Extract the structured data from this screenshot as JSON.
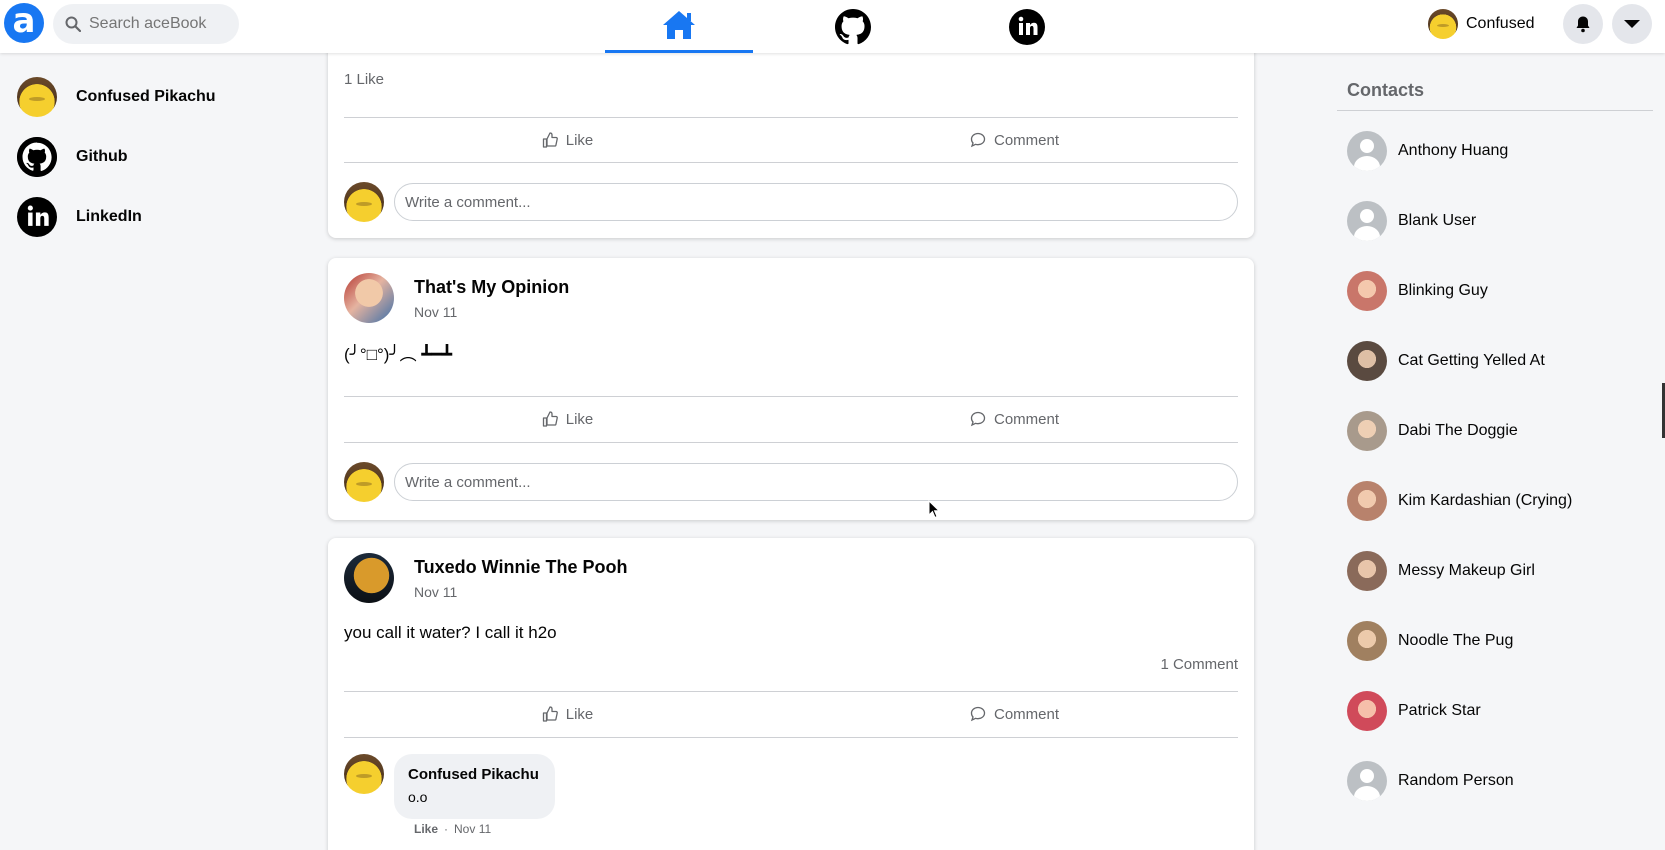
{
  "header": {
    "search_placeholder": "Search aceBook",
    "logo_letter": "a",
    "profile_name": "Confused",
    "tabs": [
      "home",
      "github",
      "linkedin"
    ],
    "active_tab": "home",
    "accent": "#1877f2"
  },
  "sidebar": {
    "items": [
      {
        "label": "Confused Pikachu",
        "icon": "pikachu-avatar"
      },
      {
        "label": "Github",
        "icon": "github-icon"
      },
      {
        "label": "LinkedIn",
        "icon": "linkedin-icon"
      }
    ]
  },
  "feed": {
    "post1": {
      "likes": "1 Like",
      "like_label": "Like",
      "comment_label": "Comment",
      "comment_placeholder": "Write a comment..."
    },
    "post2": {
      "author": "That's My Opinion",
      "date": "Nov 11",
      "text": "(╯°□°)╯︵ ┻━┻",
      "like_label": "Like",
      "comment_label": "Comment",
      "comment_placeholder": "Write a comment..."
    },
    "post3": {
      "author": "Tuxedo Winnie The Pooh",
      "date": "Nov 11",
      "text": "you call it water? I call it h2o",
      "comments_count": "1 Comment",
      "like_label": "Like",
      "comment_label": "Comment",
      "reply": {
        "author": "Confused Pikachu",
        "text": "o.o",
        "like_label": "Like",
        "separator": "·",
        "date": "Nov 11"
      }
    }
  },
  "contacts": {
    "title": "Contacts",
    "items": [
      {
        "name": "Anthony Huang",
        "avatar": "blank"
      },
      {
        "name": "Blank User",
        "avatar": "blank"
      },
      {
        "name": "Blinking Guy",
        "avatar": "photo",
        "color": "#c9766a"
      },
      {
        "name": "Cat Getting Yelled At",
        "avatar": "photo",
        "color": "#5a4a40"
      },
      {
        "name": "Dabi The Doggie",
        "avatar": "photo",
        "color": "#a89a8c"
      },
      {
        "name": "Kim Kardashian (Crying)",
        "avatar": "photo",
        "color": "#b8826c"
      },
      {
        "name": "Messy Makeup Girl",
        "avatar": "photo",
        "color": "#8a6a5a"
      },
      {
        "name": "Noodle The Pug",
        "avatar": "photo",
        "color": "#a08060"
      },
      {
        "name": "Patrick Star",
        "avatar": "photo",
        "color": "#d04a5a"
      },
      {
        "name": "Random Person",
        "avatar": "blank"
      }
    ]
  }
}
